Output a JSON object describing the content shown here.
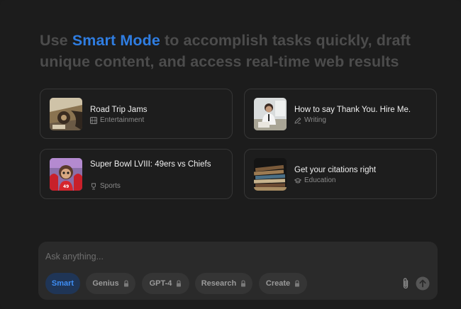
{
  "headline": {
    "prefix": "Use ",
    "accent": "Smart Mode",
    "suffix": " to accomplish tasks quickly, draft unique content, and access real-time web results"
  },
  "cards": [
    {
      "title": "Road Trip Jams",
      "category": "Entertainment",
      "category_icon": "film-icon"
    },
    {
      "title": "How to say Thank You. Hire Me.",
      "category": "Writing",
      "category_icon": "pencil-icon"
    },
    {
      "title": "Super Bowl LVIII: 49ers vs Chiefs",
      "category": "Sports",
      "category_icon": "trophy-icon"
    },
    {
      "title": "Get your citations right",
      "category": "Education",
      "category_icon": "graduation-cap-icon"
    }
  ],
  "composer": {
    "placeholder": "Ask anything...",
    "modes": [
      {
        "label": "Smart",
        "locked": false,
        "active": true
      },
      {
        "label": "Genius",
        "locked": true,
        "active": false
      },
      {
        "label": "GPT-4",
        "locked": true,
        "active": false
      },
      {
        "label": "Research",
        "locked": true,
        "active": false
      },
      {
        "label": "Create",
        "locked": true,
        "active": false
      }
    ],
    "attach_icon": "paperclip-icon",
    "send_icon": "arrow-up-icon"
  },
  "colors": {
    "accent": "#2f7de1",
    "background": "#1c1c1c",
    "headline_muted": "#4c4c4c"
  }
}
